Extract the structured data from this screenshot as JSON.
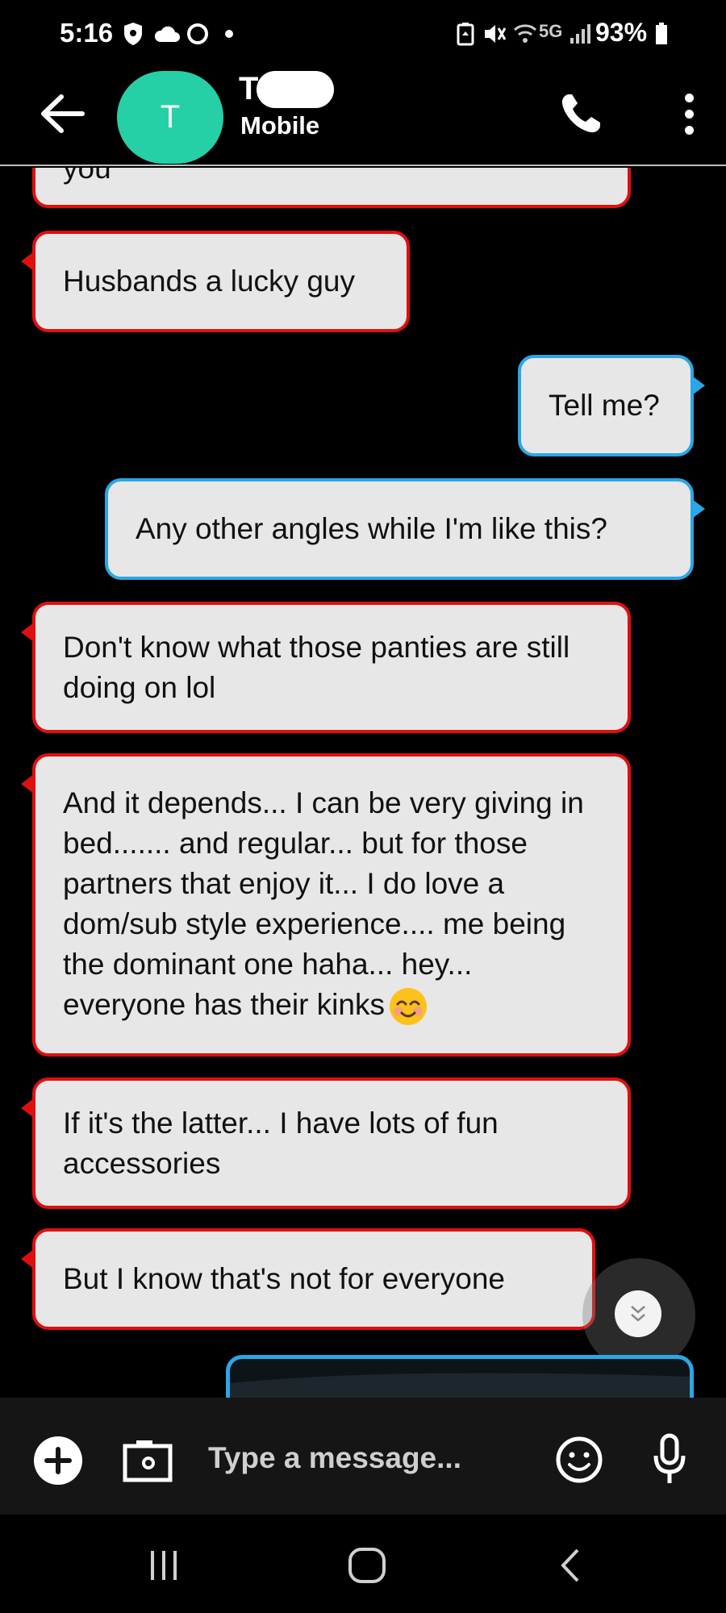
{
  "status_bar": {
    "time": "5:16",
    "network": "5G",
    "battery": "93%"
  },
  "header": {
    "avatar_letter": "T",
    "contact_name": "T",
    "contact_subtitle": "Mobile"
  },
  "messages": [
    {
      "direction": "incoming",
      "text": "you"
    },
    {
      "direction": "incoming",
      "text": "Husbands a lucky guy"
    },
    {
      "direction": "outgoing",
      "text": "Tell me?"
    },
    {
      "direction": "outgoing",
      "text": "Any other angles while I'm like this?"
    },
    {
      "direction": "incoming",
      "text": "Don't know what those panties are still doing on lol"
    },
    {
      "direction": "incoming",
      "text": "And it depends... I can be very giving in bed....... and regular... but for those partners that enjoy it... I do love a dom/sub style experience.... me being the dominant one haha... hey... everyone has their kinks"
    },
    {
      "direction": "incoming",
      "text": "If it's the latter... I have lots of fun accessories"
    },
    {
      "direction": "incoming",
      "text": "But I know that's not for everyone"
    }
  ],
  "composer": {
    "placeholder": "Type a message..."
  },
  "colors": {
    "incoming_border": "#e00f0f",
    "outgoing_border": "#29a7e6",
    "bubble_fill": "#e7e7e7",
    "avatar": "#26d0a6"
  },
  "icons": [
    "back-arrow-icon",
    "phone-icon",
    "more-vert-icon",
    "chevron-double-down-icon",
    "plus-icon",
    "camera-icon",
    "emoji-icon",
    "mic-icon",
    "recents-icon",
    "home-icon",
    "back-icon"
  ]
}
